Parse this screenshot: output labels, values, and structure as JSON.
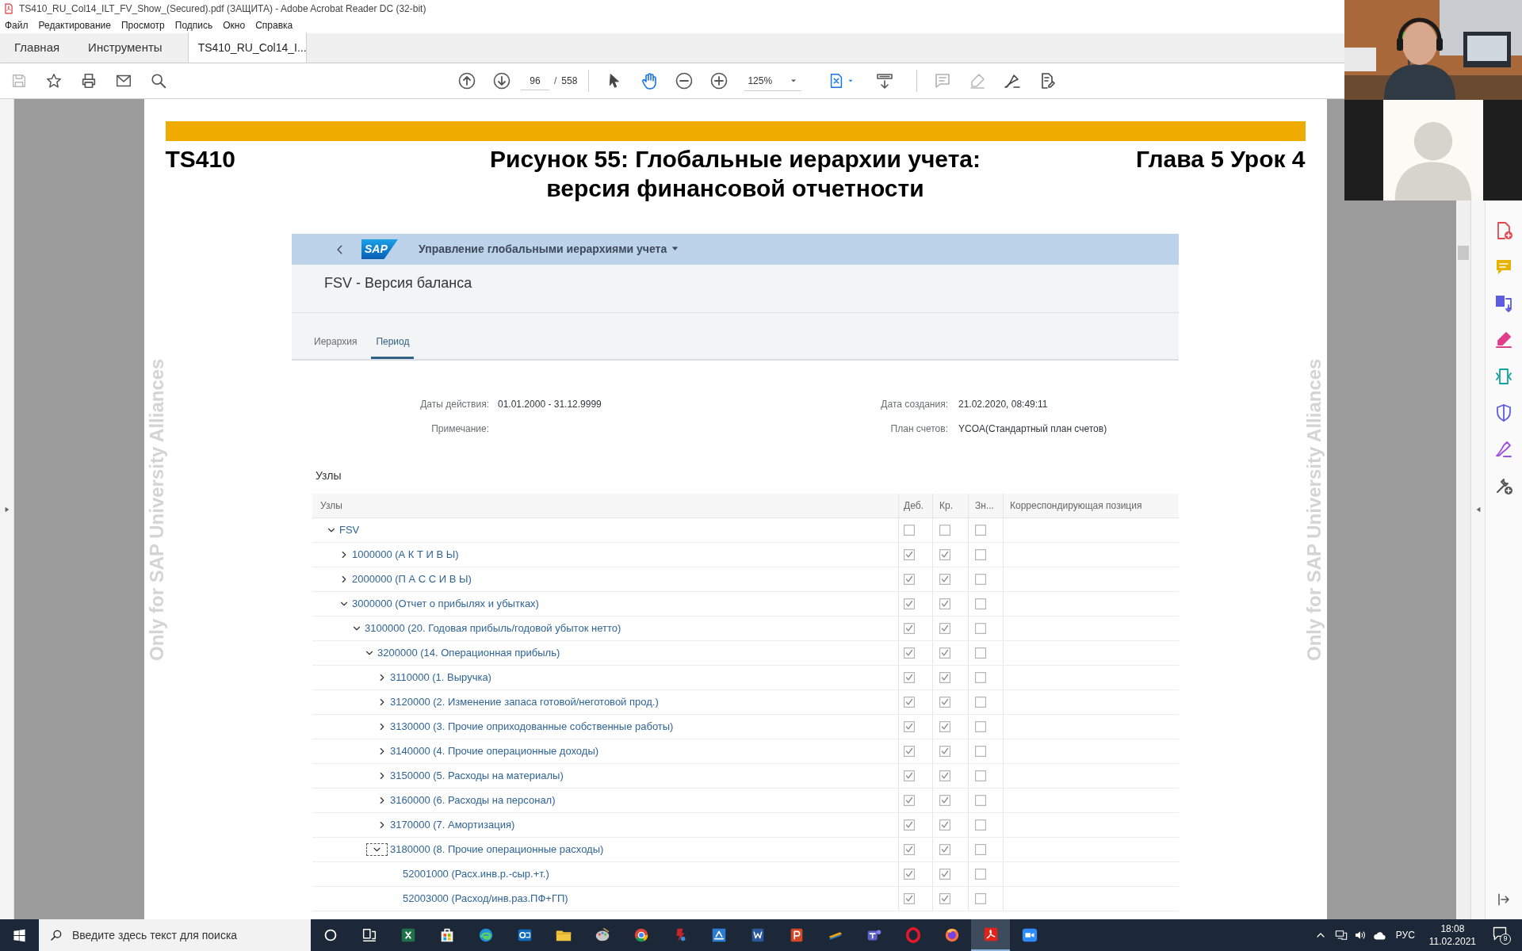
{
  "window": {
    "title": "TS410_RU_Col14_ILT_FV_Show_(Secured).pdf (ЗАЩИТА) - Adobe Acrobat Reader DC (32-bit)"
  },
  "menu": [
    "Файл",
    "Редактирование",
    "Просмотр",
    "Подпись",
    "Окно",
    "Справка"
  ],
  "tabs": [
    {
      "label": "Главная",
      "selected": false
    },
    {
      "label": "Инструменты",
      "selected": false
    },
    {
      "label": "TS410_RU_Col14_I...",
      "selected": true
    }
  ],
  "toolbar": {
    "page": "96",
    "page_separator": "/",
    "page_count": "558",
    "zoom": "125%",
    "tools": [
      {
        "kind": "pointer",
        "selected": false
      },
      {
        "kind": "hand",
        "selected": true
      }
    ]
  },
  "document": {
    "header_left": "TS410",
    "title_lines": [
      "Рисунок 55: Глобальные иерархии учета:",
      "версия финансовой отчетности"
    ],
    "header_right": "Глава 5 Урок 4",
    "watermark_left": "Only for SAP University Alliances",
    "watermark_right": "Only for SAP University Alliances",
    "sap": {
      "logo": "SAP",
      "app_title": "Управление глобальными иерархиями учета",
      "page_title": "FSV - Версия баланса",
      "tabs": [
        {
          "label": "Иерархия",
          "selected": false
        },
        {
          "label": "Период",
          "selected": true
        }
      ],
      "fields_left": [
        {
          "label": "Даты действия:",
          "value": "01.01.2000 - 31.12.9999"
        },
        {
          "label": "Примечание:"
        }
      ],
      "fields_right": [
        {
          "label": "Дата создания:",
          "value": "21.02.2020, 08:49:11"
        },
        {
          "label": "План счетов:",
          "value": "YCOA(Стандартный план счетов)"
        }
      ],
      "section_title": "Узлы",
      "table": {
        "columns": [
          "Узлы",
          "Деб.",
          "Кр.",
          "Зн...",
          "Корреспондирующая позиция"
        ],
        "tree": [
          {
            "label": "FSV",
            "expanded": true,
            "focused": false,
            "debit": false,
            "credit": false,
            "zn": false,
            "children": [
              {
                "label": "1000000 (А К Т И В Ы)",
                "expanded": false,
                "focused": false,
                "debit": true,
                "credit": true,
                "zn": false
              },
              {
                "label": "2000000 (П А С С И В Ы)",
                "expanded": false,
                "focused": false,
                "debit": true,
                "credit": true,
                "zn": false
              },
              {
                "label": "3000000 (Отчет о прибылях и убытках)",
                "expanded": true,
                "focused": false,
                "debit": true,
                "credit": true,
                "zn": false,
                "children": [
                  {
                    "label": "3100000 (20. Годовая прибыль/годовой убыток нетто)",
                    "expanded": true,
                    "focused": false,
                    "debit": true,
                    "credit": true,
                    "zn": false,
                    "children": [
                      {
                        "label": "3200000 (14. Операционная прибыль)",
                        "expanded": true,
                        "focused": false,
                        "debit": true,
                        "credit": true,
                        "zn": false,
                        "children": [
                          {
                            "label": "3110000 (1. Выручка)",
                            "expanded": false,
                            "focused": false,
                            "debit": true,
                            "credit": true,
                            "zn": false
                          },
                          {
                            "label": "3120000 (2. Изменение запаса готовой/неготовой прод.)",
                            "expanded": false,
                            "focused": false,
                            "debit": true,
                            "credit": true,
                            "zn": false
                          },
                          {
                            "label": "3130000 (3. Прочие оприходованные собственные работы)",
                            "expanded": false,
                            "focused": false,
                            "debit": true,
                            "credit": true,
                            "zn": false
                          },
                          {
                            "label": "3140000 (4. Прочие операционные доходы)",
                            "expanded": false,
                            "focused": false,
                            "debit": true,
                            "credit": true,
                            "zn": false
                          },
                          {
                            "label": "3150000 (5. Расходы на материалы)",
                            "expanded": false,
                            "focused": false,
                            "debit": true,
                            "credit": true,
                            "zn": false
                          },
                          {
                            "label": "3160000 (6. Расходы на персонал)",
                            "expanded": false,
                            "focused": false,
                            "debit": true,
                            "credit": true,
                            "zn": false
                          },
                          {
                            "label": "3170000 (7. Амортизация)",
                            "expanded": false,
                            "focused": false,
                            "debit": true,
                            "credit": true,
                            "zn": false
                          },
                          {
                            "label": "3180000 (8. Прочие операционные расходы)",
                            "expanded": true,
                            "focused": true,
                            "debit": true,
                            "credit": true,
                            "zn": false,
                            "children": [
                              {
                                "label": "52001000 (Расх.инв.р.-сыр.+т.)",
                                "focused": false,
                                "debit": true,
                                "credit": true,
                                "zn": false
                              },
                              {
                                "label": "52003000 (Расход/инв.раз.ПФ+ГП)",
                                "focused": false,
                                "debit": true,
                                "credit": true,
                                "zn": false
                              }
                            ]
                          }
                        ]
                      }
                    ]
                  }
                ]
              }
            ]
          }
        ]
      }
    }
  },
  "taskbar": {
    "search_placeholder": "Введите здесь текст для поиска",
    "language": "РУС",
    "time": "18:08",
    "date": "11.02.2021",
    "notification_count": "9"
  }
}
